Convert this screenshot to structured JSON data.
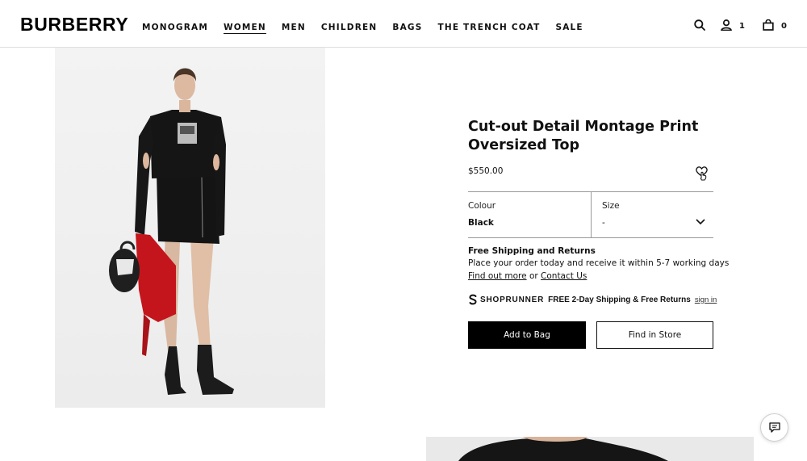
{
  "header": {
    "logo": "BURBERRY",
    "nav": [
      {
        "label": "MONOGRAM",
        "active": false
      },
      {
        "label": "WOMEN",
        "active": true
      },
      {
        "label": "MEN",
        "active": false
      },
      {
        "label": "CHILDREN",
        "active": false
      },
      {
        "label": "BAGS",
        "active": false
      },
      {
        "label": "THE TRENCH COAT",
        "active": false
      },
      {
        "label": "SALE",
        "active": false
      }
    ],
    "icons": {
      "search": "search-icon",
      "account": "user-icon",
      "bag": "shopping-bag-icon"
    },
    "account_count": "1",
    "bag_count": "0"
  },
  "product": {
    "title": "Cut-out Detail Montage Print Oversized Top",
    "price": "$550.00",
    "favourite_icon": "heart-icon",
    "colour_label": "Colour",
    "colour_value": "Black",
    "size_label": "Size",
    "size_value": "-",
    "shipping_title": "Free Shipping and Returns",
    "shipping_desc": "Place your order today and receive it within 5-7 working days",
    "find_out_more": "Find out more",
    "or_text": "or",
    "contact_us": "Contact Us",
    "shoprunner_brand": "SHOPRUNNER",
    "shoprunner_text": "FREE 2-Day Shipping & Free Returns",
    "shoprunner_link": "sign in",
    "add_to_bag": "Add to Bag",
    "find_in_store": "Find in Store"
  },
  "colors": {
    "primary": "#000000",
    "border": "#999999",
    "background": "#ffffff"
  }
}
